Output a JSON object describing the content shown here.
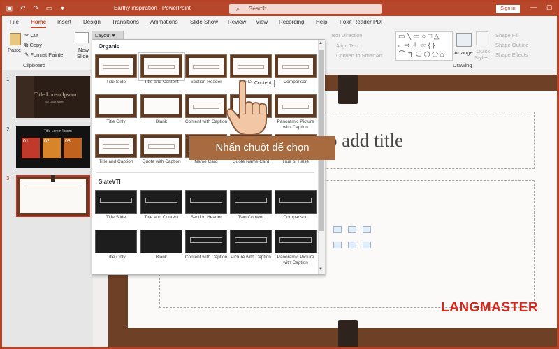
{
  "titlebar": {
    "document_title": "Earthy inspiration  -  PowerPoint",
    "search_placeholder": "Search",
    "signin_label": "Sign in"
  },
  "menu": {
    "tabs": [
      "File",
      "Home",
      "Insert",
      "Design",
      "Transitions",
      "Animations",
      "Slide Show",
      "Review",
      "View",
      "Recording",
      "Help",
      "Foxit Reader PDF"
    ],
    "active": "Home"
  },
  "ribbon": {
    "paste": "Paste",
    "cut": "Cut",
    "copy": "Copy",
    "format_painter": "Format Painter",
    "clipboard": "Clipboard",
    "new_slide": "New",
    "new_slide_2": "Slide",
    "layout": "Layout",
    "text_direction": "Text Direction",
    "align_text": "Align Text",
    "convert_smartart": "Convert to SmartArt",
    "arrange": "Arrange",
    "quick_styles": "Quick",
    "quick_styles_2": "Styles",
    "shape_fill": "Shape Fill",
    "shape_outline": "Shape Outline",
    "shape_effects": "Shape Effects",
    "drawing": "Drawing"
  },
  "slides": {
    "numbers": [
      "1",
      "2",
      "3"
    ],
    "thumb1_title": "Title Lorem Ipsum",
    "thumb1_sub": "Sit Dolor Amet",
    "thumb2_title": "Title Lorem Ipsum",
    "thumb2_tiles": [
      "01",
      "02",
      "03"
    ]
  },
  "editor": {
    "title_placeholder": "o add title"
  },
  "gallery": {
    "section1": "Organic",
    "section2": "SlateVTI",
    "organic_layouts": [
      "Title Slide",
      "Title and Content",
      "Section Header",
      "Two Content",
      "Comparison",
      "Title Only",
      "Blank",
      "Content with Caption",
      "Picture with Caption",
      "Panoramic Picture with Caption",
      "Title and Caption",
      "Quote with Caption",
      "Name Card",
      "Quote Name Card",
      "True or False"
    ],
    "slate_layouts": [
      "Title Slide",
      "Title and Content",
      "Section Header",
      "Two Content",
      "Comparison",
      "Title Only",
      "Blank",
      "Content with Caption",
      "Picture with Caption",
      "Panoramic Picture with Caption"
    ],
    "tooltip": "Content"
  },
  "annotation": {
    "callout": "Nhấn chuột để chọn"
  },
  "watermark": "LANGMASTER",
  "colors": {
    "accent": "#b7472a",
    "callout": "#a86b3f",
    "watermark": "#d5261c"
  }
}
